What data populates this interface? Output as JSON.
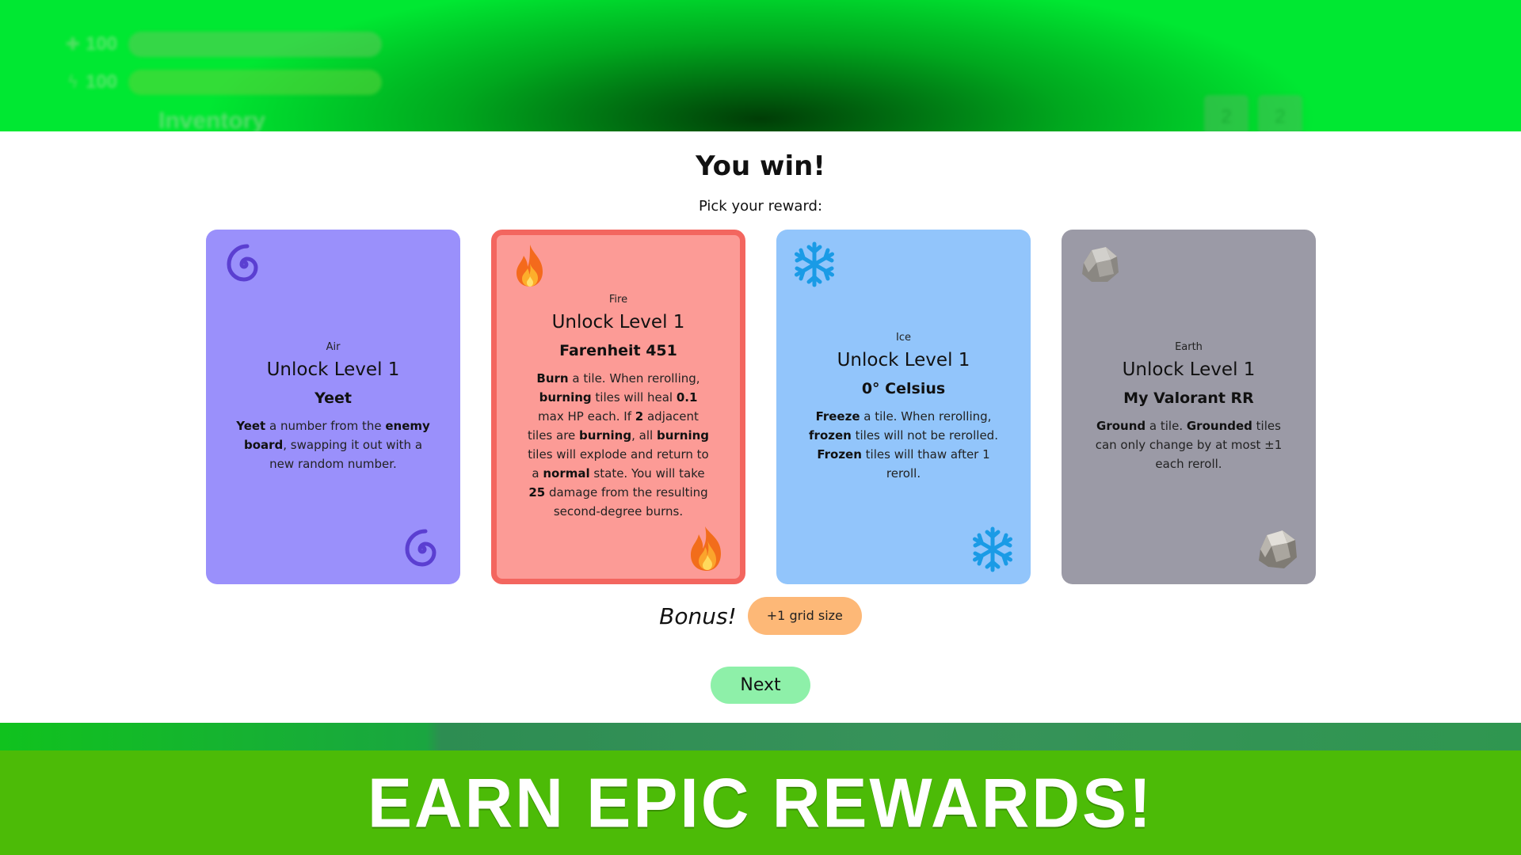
{
  "hud": {
    "hp_value": "100",
    "energy_value": "100",
    "hp_icon": "plus-icon",
    "energy_icon": "lightning-icon",
    "inventory_label": "Inventory",
    "slots": [
      "2",
      "2"
    ]
  },
  "modal": {
    "title": "You win!",
    "subtitle": "Pick your reward:",
    "cards": [
      {
        "element": "Air",
        "level": "Unlock Level 1",
        "name": "Yeet",
        "icon": "spiral-icon",
        "color": "#9a90fb",
        "description_html": "<b>Yeet</b> a number from the <b>enemy board</b>, swapping it out with a new random number."
      },
      {
        "element": "Fire",
        "level": "Unlock Level 1",
        "name": "Farenheit 451",
        "icon": "fire-icon",
        "color": "#fc9b96",
        "selected": true,
        "description_html": "<b>Burn</b> a tile. When rerolling, <b>burning</b> tiles will heal <b>0.1</b> max HP each. If <b>2</b> adjacent tiles are <b>burning</b>, all <b>burning</b> tiles will explode and return to a <b>normal</b> state. You will take <b>25</b> damage from the resulting second-degree burns."
      },
      {
        "element": "Ice",
        "level": "Unlock Level 1",
        "name": "0° Celsius",
        "icon": "snowflake-icon",
        "color": "#92c5fb",
        "description_html": "<b>Freeze</b> a tile. When rerolling, <b>frozen</b> tiles will not be rerolled. <b>Frozen</b> tiles will thaw after 1 reroll."
      },
      {
        "element": "Earth",
        "level": "Unlock Level 1",
        "name": "My Valorant RR",
        "icon": "rock-icon",
        "color": "#9b9aa6",
        "description_html": "<b>Ground</b> a tile. <b>Grounded</b> tiles can only change by at most ±1 each reroll."
      }
    ],
    "bonus_label": "Bonus!",
    "bonus_value": "+1 grid size",
    "next_label": "Next"
  },
  "banner": {
    "text": "EARN EPIC REWARDS!"
  }
}
